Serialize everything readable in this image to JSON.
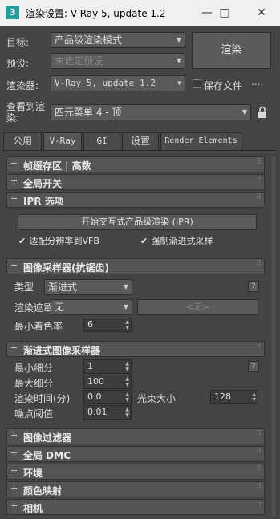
{
  "window": {
    "app_icon": "3",
    "title": "渲染设置: V-Ray 5, update 1.2",
    "minimize_icon": "minimize-icon",
    "maximize_icon": "maximize-icon",
    "close_icon": "close-icon"
  },
  "header": {
    "target_label": "目标:",
    "target_value": "产品级渲染模式",
    "preset_label": "预设:",
    "preset_value": "未选定预设",
    "renderer_label": "渲染器:",
    "renderer_value": "V-Ray 5, update 1.2",
    "save_file_label": "保存文件",
    "more_dots": "...",
    "render_button": "渲染",
    "view_label_line1": "查看到渲",
    "view_label_line2": "染:",
    "view_value": "四元菜单 4 - 顶",
    "lock_icon": "lock-icon"
  },
  "tabs": [
    "公用",
    "V-Ray",
    "GI",
    "设置",
    "Render Elements"
  ],
  "active_tab": "V-Ray",
  "rollouts": {
    "framebuffer": "帧缓存区 | 高数",
    "global_switches": "全局开关",
    "ipr": "IPR 选项",
    "image_sampler": "图像采样器(抗锯齿)",
    "progressive_sampler": "渐进式图像采样器",
    "image_filter": "图像过滤器",
    "global_dmc": "全局 DMC",
    "environment": "环境",
    "color_mapping": "颜色映射",
    "camera": "相机"
  },
  "ipr": {
    "start_button": "开始交互式产品级渲染 (IPR)",
    "fit_vfb_label": "适配分辨率到VFB",
    "fit_vfb_checked": true,
    "force_progressive_label": "强制渐进式采样",
    "force_progressive_checked": true
  },
  "image_sampler": {
    "type_label": "类型",
    "type_value": "渐进式",
    "mask_label": "渲染遮罩",
    "mask_value": "无",
    "mask_map": "<无>",
    "min_shading_label": "最小着色率",
    "min_shading_value": "6",
    "help": "?"
  },
  "progressive": {
    "min_subdivs_label": "最小细分",
    "min_subdivs_value": "1",
    "max_subdivs_label": "最大细分",
    "max_subdivs_value": "100",
    "render_time_label": "渲染时间(分)",
    "render_time_value": "0.0",
    "bundle_size_label": "光束大小",
    "bundle_size_value": "128",
    "noise_label": "噪点阈值",
    "noise_value": "0.01",
    "help": "?"
  }
}
